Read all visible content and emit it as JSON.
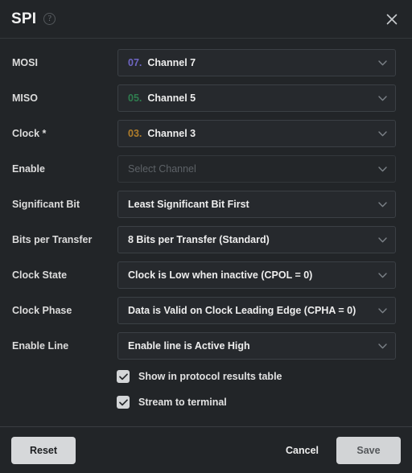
{
  "header": {
    "title": "SPI",
    "help_icon": "question-mark-circle-icon",
    "help_glyph": "?",
    "close_icon": "close-icon"
  },
  "colors": {
    "background": "#222528",
    "field_bg": "#26292d",
    "field_border": "#3b4045",
    "label": "#dcdcdc",
    "placeholder": "#5d6267",
    "channel_7": "#6f66c4",
    "channel_5": "#2f7d4f",
    "channel_3": "#b07d2a",
    "button_light": "#d6d8da"
  },
  "form": {
    "rows": [
      {
        "label": "MOSI",
        "num": "07.",
        "num_color": "#6f66c4",
        "value": "Channel 7",
        "placeholder": "",
        "empty": false
      },
      {
        "label": "MISO",
        "num": "05.",
        "num_color": "#2f7d4f",
        "value": "Channel 5",
        "placeholder": "",
        "empty": false
      },
      {
        "label": "Clock *",
        "num": "03.",
        "num_color": "#b07d2a",
        "value": "Channel 3",
        "placeholder": "",
        "empty": false
      },
      {
        "label": "Enable",
        "num": "",
        "num_color": "",
        "value": "",
        "placeholder": "Select Channel",
        "empty": true
      },
      {
        "label": "Significant Bit",
        "num": "",
        "num_color": "",
        "value": "Least Significant Bit First",
        "placeholder": "",
        "empty": false
      },
      {
        "label": "Bits per Transfer",
        "num": "",
        "num_color": "",
        "value": "8 Bits per Transfer (Standard)",
        "placeholder": "",
        "empty": false
      },
      {
        "label": "Clock State",
        "num": "",
        "num_color": "",
        "value": "Clock is Low when inactive (CPOL = 0)",
        "placeholder": "",
        "empty": false
      },
      {
        "label": "Clock Phase",
        "num": "",
        "num_color": "",
        "value": "Data is Valid on Clock Leading Edge (CPHA = 0)",
        "placeholder": "",
        "empty": false
      },
      {
        "label": "Enable Line",
        "num": "",
        "num_color": "",
        "value": "Enable line is Active High",
        "placeholder": "",
        "empty": false
      }
    ],
    "checkboxes": [
      {
        "label": "Show in protocol results table",
        "checked": true
      },
      {
        "label": "Stream to terminal",
        "checked": true
      }
    ]
  },
  "footer": {
    "reset_label": "Reset",
    "cancel_label": "Cancel",
    "save_label": "Save"
  }
}
